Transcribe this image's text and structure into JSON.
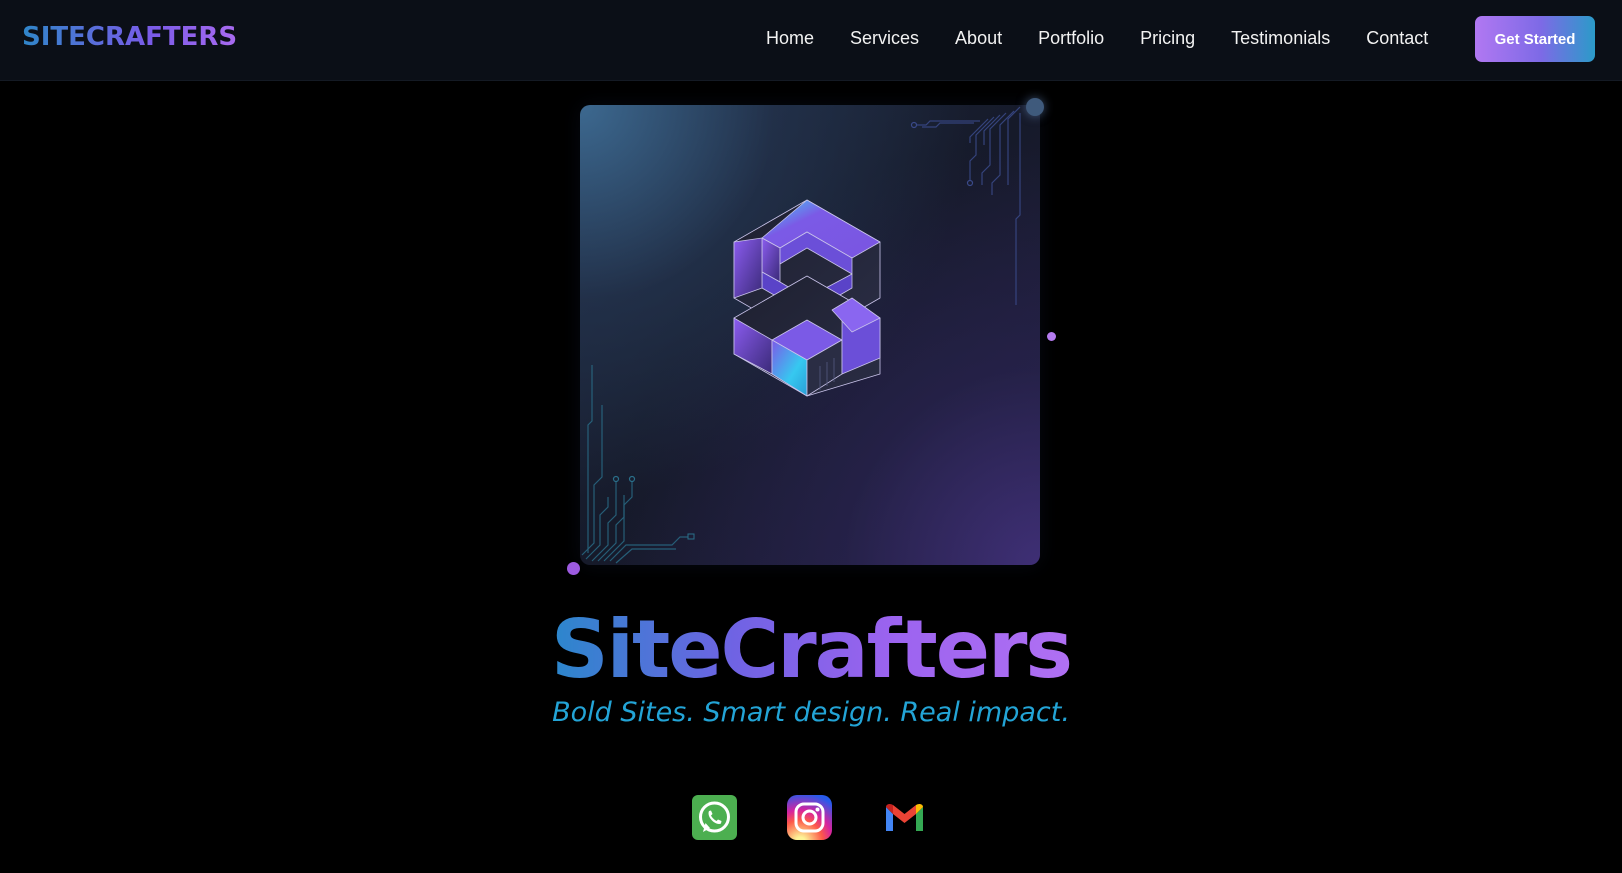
{
  "nav": {
    "brand": "SITECRAFTERS",
    "links": [
      "Home",
      "Services",
      "About",
      "Portfolio",
      "Pricing",
      "Testimonials",
      "Contact"
    ],
    "cta_label": "Get Started"
  },
  "hero": {
    "title": "SiteCrafters",
    "tagline": "Bold Sites. Smart design. Real impact.",
    "logo_icon": "isometric-s-cube-logo-icon"
  },
  "socials": {
    "items": [
      {
        "name": "whatsapp",
        "icon": "whatsapp-icon",
        "color": "#4caf50"
      },
      {
        "name": "instagram",
        "icon": "instagram-icon",
        "color": "#d6249f"
      },
      {
        "name": "gmail",
        "icon": "gmail-icon",
        "color": "#ea4335"
      }
    ]
  },
  "colors": {
    "background": "#000000",
    "navbar": "#0b0f17",
    "accent_blue": "#2b87cc",
    "accent_purple": "#9b63ef",
    "tagline": "#23a4d6"
  }
}
